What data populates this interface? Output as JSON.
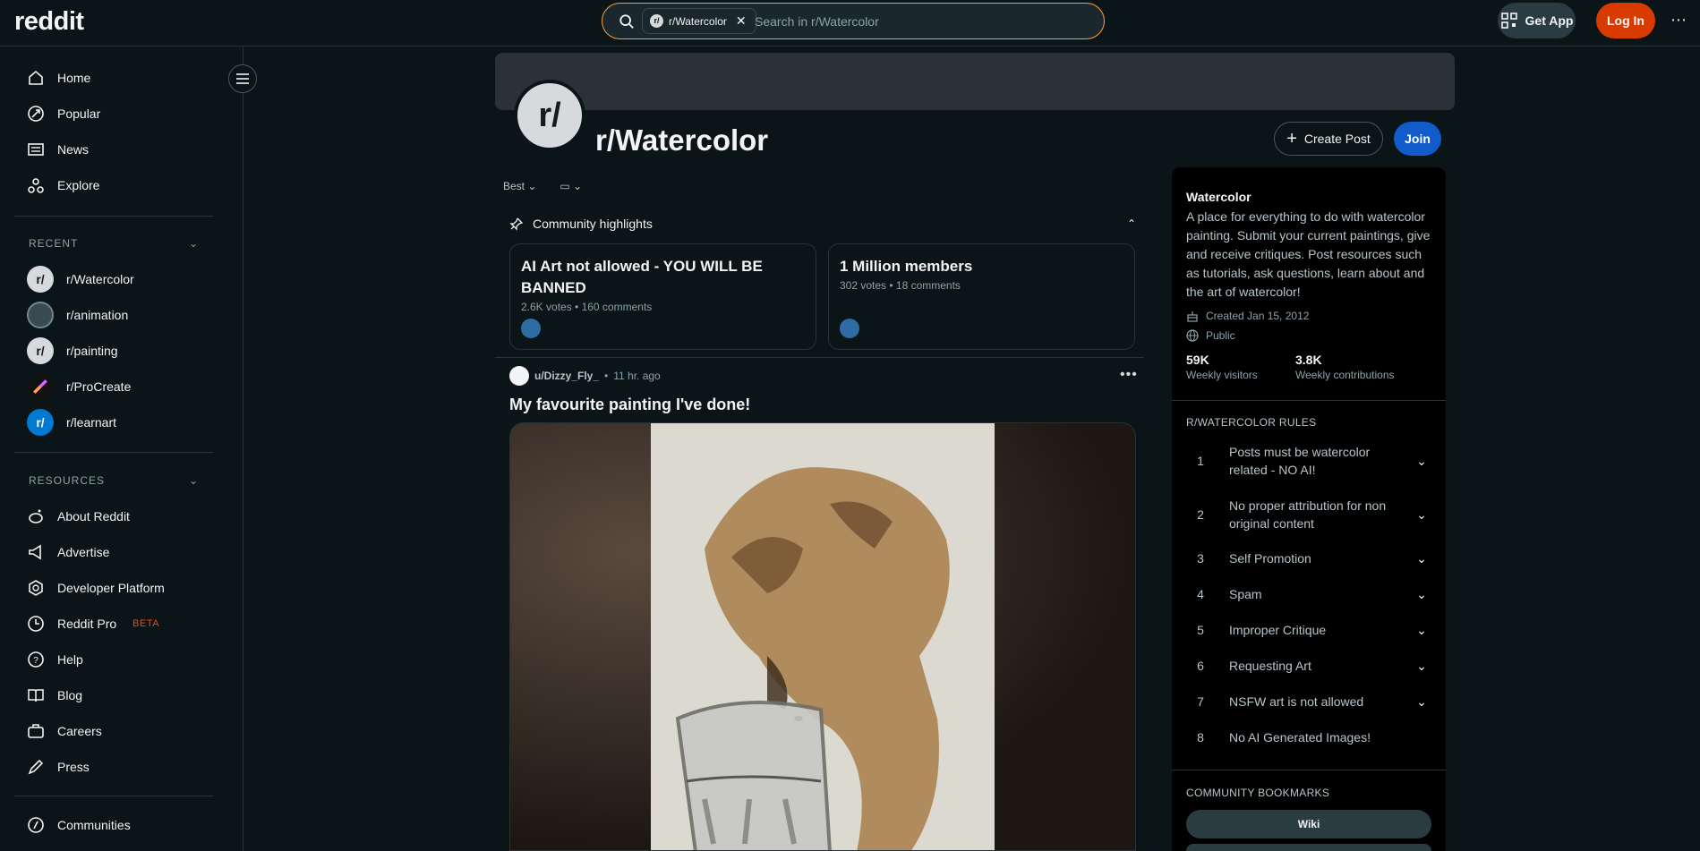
{
  "header": {
    "logo": "reddit",
    "search_chip": "r/Watercolor",
    "search_placeholder": "Search in r/Watercolor",
    "get_app": "Get App",
    "log_in": "Log In"
  },
  "sidebar": {
    "main": [
      {
        "label": "Home",
        "icon": "home-icon"
      },
      {
        "label": "Popular",
        "icon": "popular-icon"
      },
      {
        "label": "News",
        "icon": "news-icon"
      },
      {
        "label": "Explore",
        "icon": "explore-icon"
      }
    ],
    "recent_title": "RECENT",
    "recent": [
      {
        "label": "r/Watercolor"
      },
      {
        "label": "r/animation"
      },
      {
        "label": "r/painting"
      },
      {
        "label": "r/ProCreate"
      },
      {
        "label": "r/learnart"
      }
    ],
    "resources_title": "RESOURCES",
    "resources": [
      {
        "label": "About Reddit",
        "icon": "reddit-icon"
      },
      {
        "label": "Advertise",
        "icon": "megaphone-icon"
      },
      {
        "label": "Developer Platform",
        "icon": "developer-icon"
      },
      {
        "label": "Reddit Pro",
        "icon": "pro-icon",
        "badge": "BETA"
      },
      {
        "label": "Help",
        "icon": "help-icon"
      },
      {
        "label": "Blog",
        "icon": "blog-icon"
      },
      {
        "label": "Careers",
        "icon": "briefcase-icon"
      },
      {
        "label": "Press",
        "icon": "pen-icon"
      }
    ],
    "communities": "Communities"
  },
  "community": {
    "avatar_text": "r/",
    "title": "r/Watercolor",
    "create_post": "Create Post",
    "join": "Join"
  },
  "feed": {
    "sort": "Best",
    "highlights_title": "Community highlights",
    "highlights": [
      {
        "title": "AI Art not allowed - YOU WILL BE BANNED",
        "meta": "2.6K votes • 160 comments"
      },
      {
        "title": "1 Million members",
        "meta": "302 votes • 18 comments"
      }
    ],
    "post": {
      "author": "u/Dizzy_Fly_",
      "dot": "•",
      "time": "11 hr. ago",
      "title": "My favourite painting I've done!"
    }
  },
  "about": {
    "name": "Watercolor",
    "description": "A place for everything to do with watercolor painting. Submit your current paintings, give and receive critiques. Post resources such as tutorials, ask questions, learn about and the art of watercolor!",
    "created": "Created Jan 15, 2012",
    "visibility": "Public",
    "visitors_value": "59K",
    "visitors_label": "Weekly visitors",
    "contrib_value": "3.8K",
    "contrib_label": "Weekly contributions",
    "rules_title": "R/WATERCOLOR RULES",
    "rules": [
      {
        "num": "1",
        "text": "Posts must be watercolor related - NO AI!"
      },
      {
        "num": "2",
        "text": "No proper attribution for non original content"
      },
      {
        "num": "3",
        "text": "Self Promotion"
      },
      {
        "num": "4",
        "text": "Spam"
      },
      {
        "num": "5",
        "text": "Improper Critique"
      },
      {
        "num": "6",
        "text": "Requesting Art"
      },
      {
        "num": "7",
        "text": "NSFW art is not allowed"
      },
      {
        "num": "8",
        "text": "No AI Generated Images!"
      }
    ],
    "bookmarks_title": "COMMUNITY BOOKMARKS",
    "bookmark_wiki": "Wiki"
  },
  "colors": {
    "background": "#0b1416",
    "accent_orange": "#d93a00",
    "join_blue": "#115bca",
    "beta_orange": "#ff4500"
  }
}
